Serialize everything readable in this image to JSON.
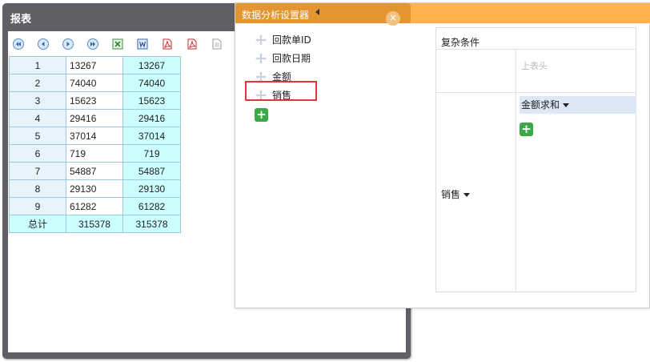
{
  "report": {
    "title": "报表",
    "toolbar": [
      {
        "name": "first-page-icon"
      },
      {
        "name": "prev-page-icon"
      },
      {
        "name": "next-page-icon"
      },
      {
        "name": "last-page-icon"
      },
      {
        "name": "export-excel-icon"
      },
      {
        "name": "export-word-icon"
      },
      {
        "name": "export-pdf-icon"
      },
      {
        "name": "export-pdf-alt-icon"
      },
      {
        "name": "export-text-icon"
      }
    ],
    "rows": [
      {
        "index": "1",
        "a": "13267",
        "b": "13267"
      },
      {
        "index": "2",
        "a": "74040",
        "b": "74040"
      },
      {
        "index": "3",
        "a": "15623",
        "b": "15623"
      },
      {
        "index": "4",
        "a": "29416",
        "b": "29416"
      },
      {
        "index": "5",
        "a": "37014",
        "b": "37014"
      },
      {
        "index": "6",
        "a": "719",
        "b": "719"
      },
      {
        "index": "7",
        "a": "54887",
        "b": "54887"
      },
      {
        "index": "8",
        "a": "29130",
        "b": "29130"
      },
      {
        "index": "9",
        "a": "61282",
        "b": "61282"
      }
    ],
    "total": {
      "label": "总计",
      "a": "315378",
      "b": "315378"
    }
  },
  "settings": {
    "title": "数据分析设置器",
    "close_glyph": "×",
    "fields": [
      {
        "label": "回款单ID"
      },
      {
        "label": "回款日期"
      },
      {
        "label": "金额"
      },
      {
        "label": "销售"
      }
    ],
    "add_glyph": "+",
    "condition": {
      "title": "复杂条件",
      "column_header_placeholder": "上表头",
      "row_field": "销售",
      "measure": "金额求和",
      "add_glyph": "+"
    }
  },
  "colors": {
    "accent": "#fdb24e",
    "accent_dark": "#e3962f",
    "highlight": "#e0363a",
    "add_green": "#3ba946"
  }
}
